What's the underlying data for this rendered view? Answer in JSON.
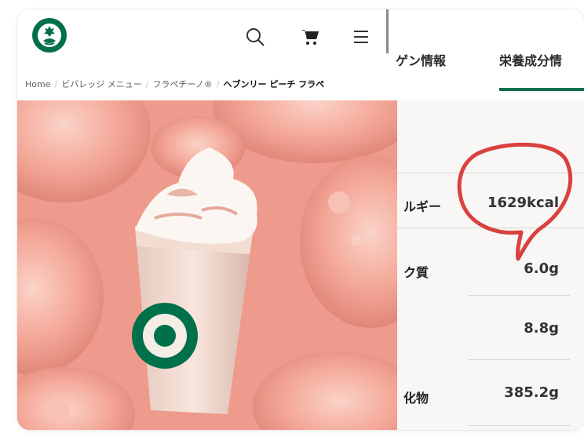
{
  "header": {
    "logo_icon": "starbucks-siren-logo",
    "icons": [
      "search-icon",
      "cart-icon",
      "hamburger-menu-icon"
    ]
  },
  "breadcrumb": {
    "items": [
      "Home",
      "ビバレッジ メニュー",
      "フラペチーノ®",
      "ヘブンリー ピーチ フラペ"
    ]
  },
  "tabs": {
    "left_label": "ゲン情報",
    "right_label": "栄養成分情"
  },
  "nutrition": {
    "rows": [
      {
        "label": "ルギー",
        "value": "1629kcal"
      },
      {
        "label": "ク質",
        "value": "6.0g"
      },
      {
        "label": "",
        "value": "8.8g"
      },
      {
        "label": "化物",
        "value": "385.2g"
      }
    ]
  },
  "colors": {
    "brand_green": "#00704a",
    "annotation_red": "#d9413f",
    "hero_peach": "#f0a89a"
  }
}
